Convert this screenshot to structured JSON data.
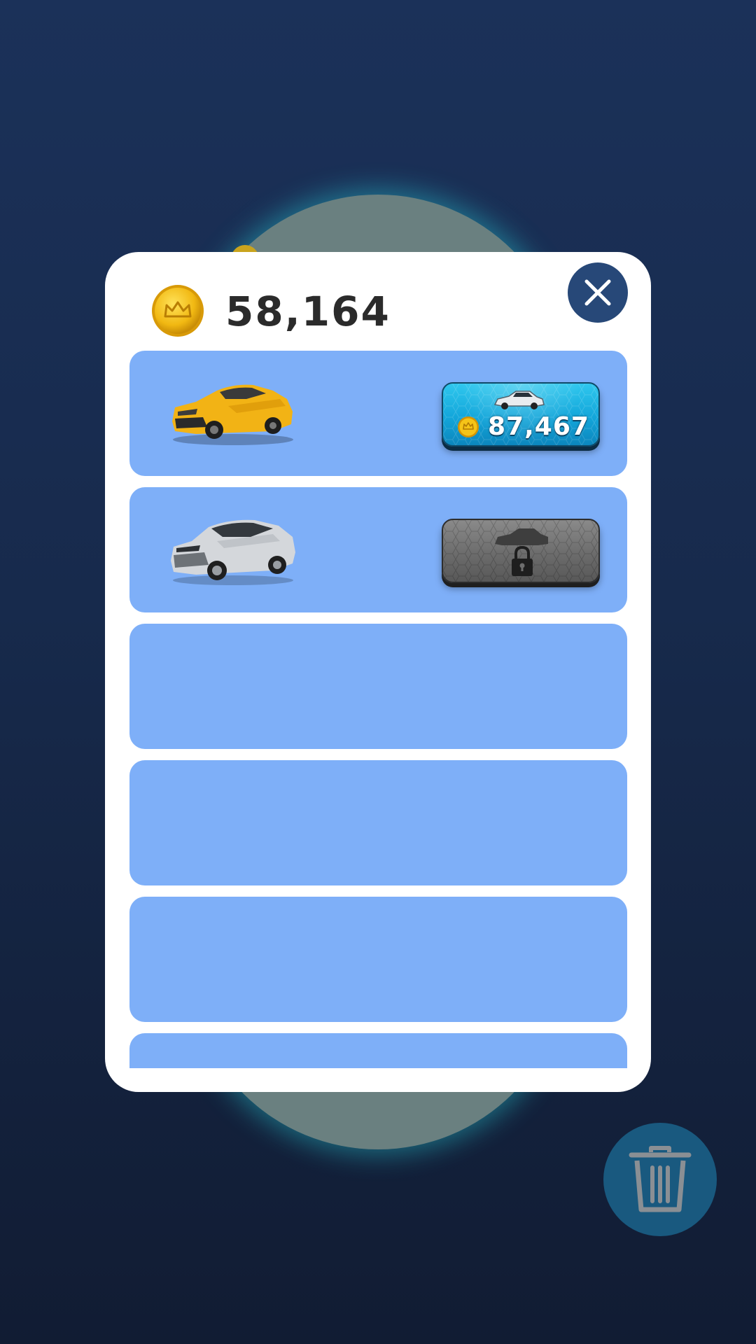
{
  "balance": {
    "coins": "58,164",
    "coin_icon": "crown-coin-icon"
  },
  "close": {
    "icon": "close-icon"
  },
  "cars": [
    {
      "name": "yellow-sports-car",
      "color": "#f2b315",
      "state": "for-sale",
      "price": "87,467"
    },
    {
      "name": "silver-sedan-car",
      "color": "#c9ccd1",
      "state": "locked"
    },
    {
      "state": "empty"
    },
    {
      "state": "empty"
    },
    {
      "state": "empty"
    },
    {
      "state": "empty"
    }
  ],
  "trash": {
    "icon": "trash-icon"
  },
  "colors": {
    "accent": "#274878",
    "row_bg": "#7eaff8",
    "buy_button": "#13a6da",
    "locked_button": "#6c6c6c"
  }
}
